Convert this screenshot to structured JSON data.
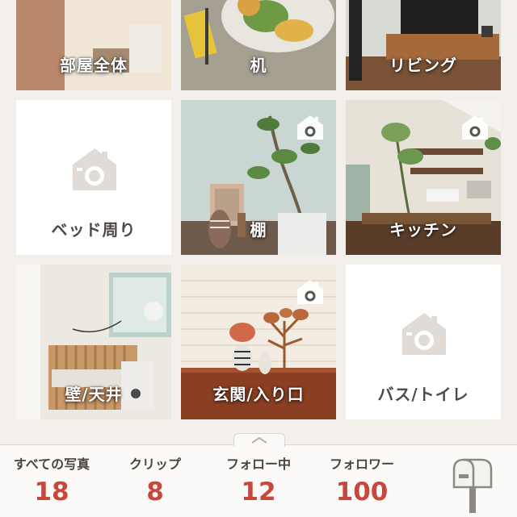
{
  "colors": {
    "background": "#f3efeb",
    "count": "#c8463c",
    "label_dark": "#4f4a45",
    "placeholder_icon": "#e0dbd6"
  },
  "rooms": [
    {
      "label": "部屋全体",
      "has_photo": true
    },
    {
      "label": "机",
      "has_photo": true
    },
    {
      "label": "リビング",
      "has_photo": true
    },
    {
      "label": "ベッド周り",
      "has_photo": false,
      "icon": "home-camera-icon"
    },
    {
      "label": "棚",
      "has_photo": true,
      "icon": "home-camera-icon"
    },
    {
      "label": "キッチン",
      "has_photo": true,
      "icon": "home-camera-icon"
    },
    {
      "label": "壁/天井",
      "has_photo": true
    },
    {
      "label": "玄関/入り口",
      "has_photo": true,
      "icon": "home-camera-icon"
    },
    {
      "label": "バス/トイレ",
      "has_photo": false,
      "icon": "home-camera-icon"
    }
  ],
  "stats": [
    {
      "label": "すべての写真",
      "count": "18"
    },
    {
      "label": "クリップ",
      "count": "8"
    },
    {
      "label": "フォロー中",
      "count": "12"
    },
    {
      "label": "フォロワー",
      "count": "100"
    }
  ],
  "icons": {
    "pull_tab": "chevron-up-icon",
    "mailbox": "mailbox-icon"
  }
}
